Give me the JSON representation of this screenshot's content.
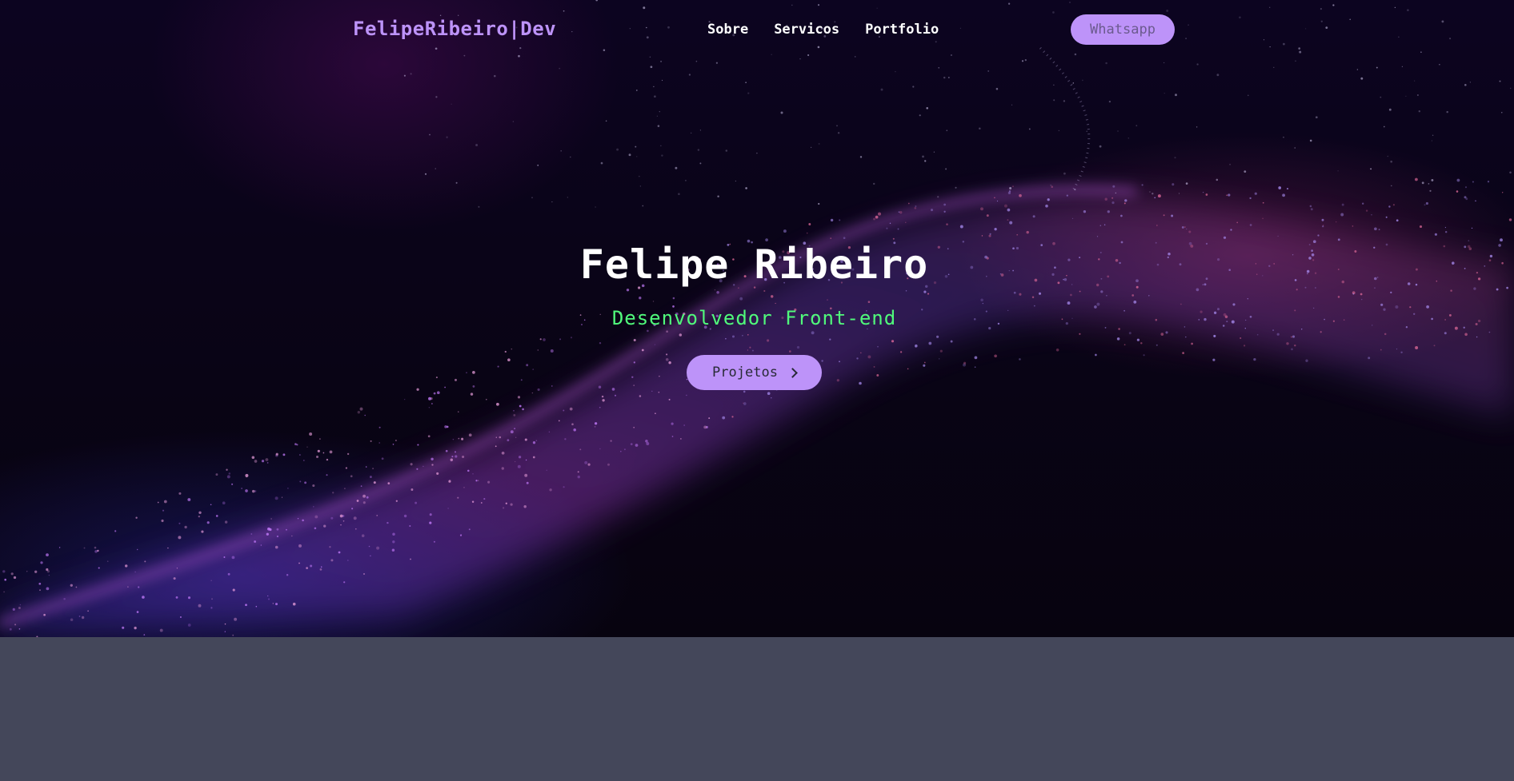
{
  "header": {
    "logo": "FelipeRibeiro|Dev",
    "nav": [
      {
        "label": "Sobre"
      },
      {
        "label": "Servicos"
      },
      {
        "label": "Portfolio"
      }
    ],
    "cta_label": "Whatsapp"
  },
  "hero": {
    "title": "Felipe Ribeiro",
    "subtitle": "Desenvolvedor Front-end",
    "button_label": "Projetos",
    "button_icon": "chevron-right-icon",
    "background": "purple particle wave"
  },
  "colors": {
    "accent": "#bd93f9",
    "subtitle": "#50fa7b",
    "footer_band": "#44475a",
    "hero_bg": "#0a0418"
  }
}
